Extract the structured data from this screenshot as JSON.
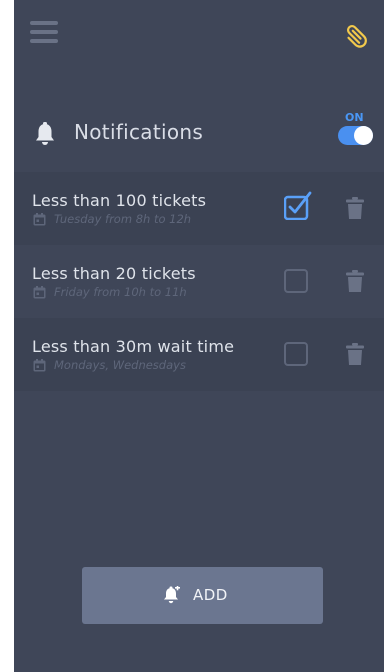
{
  "header": {
    "menu_icon": "hamburger-menu-icon",
    "right_icon": "paperclip-icon",
    "accent_color": "#f2c94c"
  },
  "notifications": {
    "title": "Notifications",
    "toggle_label": "ON",
    "enabled": true,
    "toggle_color": "#4a90f0"
  },
  "alerts": [
    {
      "title": "Less than 100 tickets",
      "schedule": "Tuesday from 8h to 12h",
      "checked": true
    },
    {
      "title": "Less than 20 tickets",
      "schedule": "Friday from 10h to 11h",
      "checked": false
    },
    {
      "title": "Less than 30m wait time",
      "schedule": "Mondays, Wednesdays",
      "checked": false
    }
  ],
  "add_button": {
    "label": "ADD",
    "icon": "bell-plus-icon"
  }
}
